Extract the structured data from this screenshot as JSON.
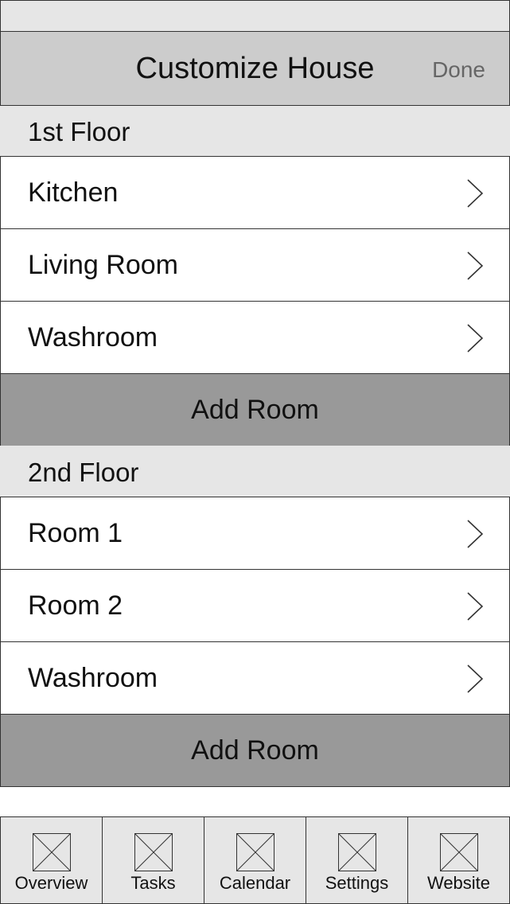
{
  "navbar": {
    "title": "Customize House",
    "done_label": "Done"
  },
  "sections": [
    {
      "header": "1st Floor",
      "rooms": [
        "Kitchen",
        "Living Room",
        "Washroom"
      ],
      "add_label": "Add Room"
    },
    {
      "header": "2nd Floor",
      "rooms": [
        "Room 1",
        "Room 2",
        "Washroom"
      ],
      "add_label": "Add Room"
    }
  ],
  "tabs": [
    {
      "label": "Overview",
      "icon": "placeholder-image-icon"
    },
    {
      "label": "Tasks",
      "icon": "placeholder-image-icon"
    },
    {
      "label": "Calendar",
      "icon": "placeholder-image-icon"
    },
    {
      "label": "Settings",
      "icon": "placeholder-image-icon"
    },
    {
      "label": "Website",
      "icon": "placeholder-image-icon"
    }
  ],
  "colors": {
    "navbar_bg": "#cccccc",
    "section_bg": "#e6e6e6",
    "add_button_bg": "#999999",
    "done_text": "#666666"
  }
}
